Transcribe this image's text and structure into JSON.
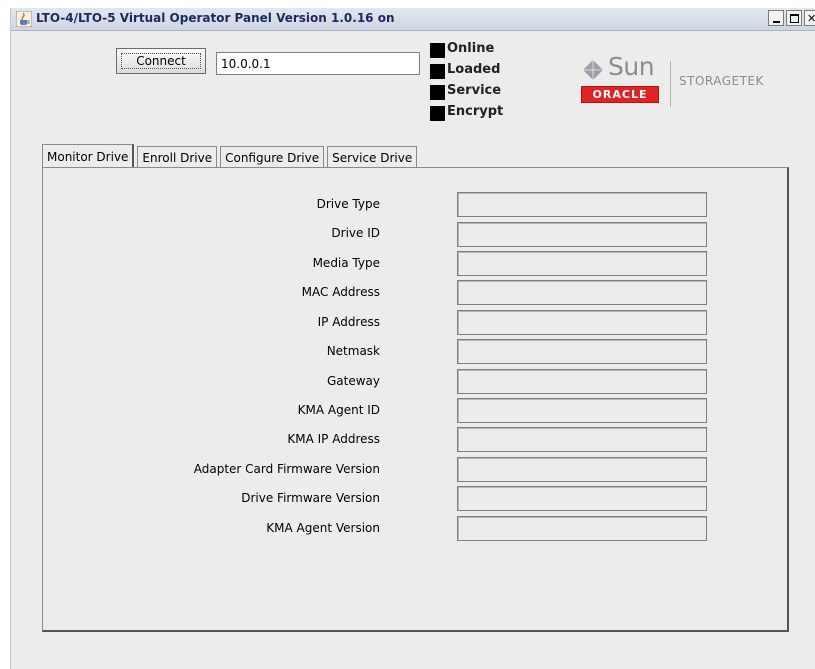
{
  "window": {
    "title": "LTO-4/LTO-5 Virtual Operator Panel Version 1.0.16 on",
    "buttons": [
      "minimize",
      "maximize",
      "close"
    ],
    "icon": "java-cup-icon"
  },
  "connection": {
    "connect_label": "Connect",
    "ip_value": "10.0.0.1"
  },
  "status": [
    {
      "label": "Online",
      "color": "#000000"
    },
    {
      "label": "Loaded",
      "color": "#000000"
    },
    {
      "label": "Service",
      "color": "#000000"
    },
    {
      "label": "Encrypt",
      "color": "#000000"
    }
  ],
  "branding": {
    "sun": "Sun",
    "oracle": "ORACLE",
    "storagetek": "STORAGETEK",
    "oracle_color": "#e02326"
  },
  "tabs": [
    {
      "label": "Monitor Drive",
      "active": true
    },
    {
      "label": "Enroll Drive",
      "active": false
    },
    {
      "label": "Configure Drive",
      "active": false
    },
    {
      "label": "Service Drive",
      "active": false
    }
  ],
  "fields": [
    {
      "label": "Drive Type",
      "value": ""
    },
    {
      "label": "Drive ID",
      "value": ""
    },
    {
      "label": "Media Type",
      "value": ""
    },
    {
      "label": "MAC Address",
      "value": ""
    },
    {
      "label": "IP Address",
      "value": ""
    },
    {
      "label": "Netmask",
      "value": ""
    },
    {
      "label": "Gateway",
      "value": ""
    },
    {
      "label": "KMA Agent ID",
      "value": ""
    },
    {
      "label": "KMA IP Address",
      "value": ""
    },
    {
      "label": "Adapter Card Firmware Version",
      "value": ""
    },
    {
      "label": "Drive Firmware Version",
      "value": ""
    },
    {
      "label": "KMA Agent Version",
      "value": ""
    }
  ]
}
